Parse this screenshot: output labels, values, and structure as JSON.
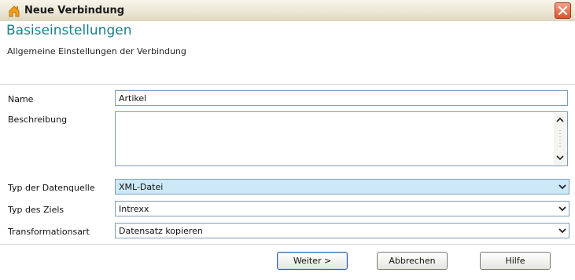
{
  "window": {
    "title": "Neue Verbindung"
  },
  "header": {
    "title": "Basiseinstellungen",
    "subtitle": "Allgemeine Einstellungen der Verbindung"
  },
  "form": {
    "name_label": "Name",
    "name_value": "Artikel",
    "description_label": "Beschreibung",
    "description_value": "",
    "source_type_label": "Typ der Datenquelle",
    "source_type_value": "XML-Datei",
    "target_type_label": "Typ des Ziels",
    "target_type_value": "Intrexx",
    "transform_label": "Transformationsart",
    "transform_value": "Datensatz kopieren"
  },
  "buttons": {
    "next": "Weiter >",
    "cancel": "Abbrechen",
    "help": "Hilfe"
  },
  "colors": {
    "heading": "#1b7d8c",
    "selected_combo": "#cde8f7",
    "close_button": "#d9542d"
  },
  "icons": {
    "app": "house-icon",
    "close": "close-icon",
    "dropdown": "chevron-down-icon"
  }
}
